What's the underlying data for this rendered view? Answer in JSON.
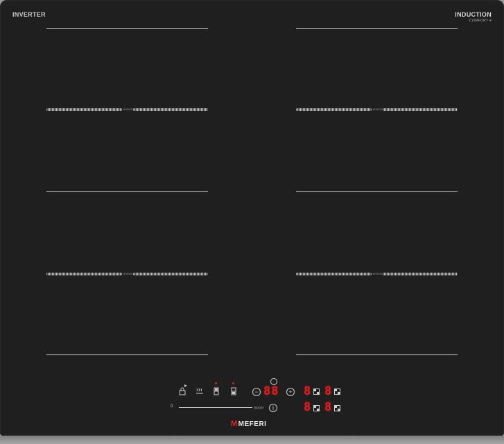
{
  "branding": {
    "left_label": "INVERTER",
    "right_label": "INDUCTION",
    "right_sub_label": "COMFORT 4",
    "logo_text": "MEFERI",
    "logo_mark": "M"
  },
  "zones": {
    "bridge_label": "BRIDGE"
  },
  "controls": {
    "center_display": "88",
    "zone_displays": [
      "8",
      "8",
      "8",
      "8"
    ],
    "slider_min_label": "0",
    "slider_max_label": "BOOST",
    "icons": [
      "lock-icon",
      "keep-warm-icon",
      "flex-zone-icon",
      "flex-zone-icon",
      "minus-icon",
      "plus-icon",
      "timer-icon",
      "info-icon",
      "zone-indicator-icon"
    ],
    "display_color": "#e21c1c",
    "indicator_color": "#d42222"
  },
  "colors": {
    "glass": "#1f1f20",
    "lines": "#cfcfcf"
  }
}
